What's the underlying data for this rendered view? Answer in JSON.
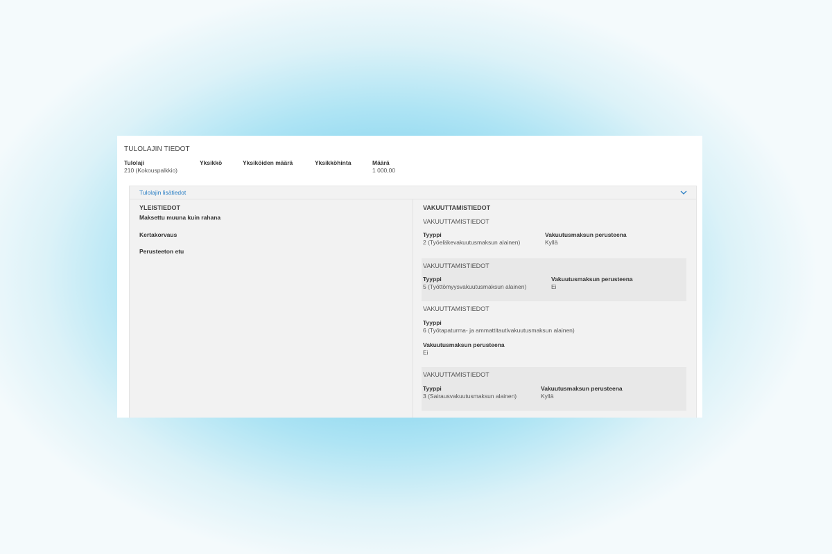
{
  "section_title": "TULOLAJIN TIEDOT",
  "summary": {
    "columns": [
      {
        "label": "Tulolaji",
        "value": "210 (Kokouspalkkio)"
      },
      {
        "label": "Yksikkö",
        "value": ""
      },
      {
        "label": "Yksiköiden määrä",
        "value": ""
      },
      {
        "label": "Yksikköhinta",
        "value": ""
      },
      {
        "label": "Määrä",
        "value": "1 000,00"
      }
    ]
  },
  "details": {
    "title": "Tulolajin lisätiedot",
    "general": {
      "heading": "YLEISTIEDOT",
      "items": [
        "Maksettu muuna kuin rahana",
        "Kertakorvaus",
        "Perusteeton etu"
      ]
    },
    "insurance": {
      "heading": "VAKUUTTAMISTIEDOT",
      "blocks": [
        {
          "heading": "VAKUUTTAMISTIEDOT",
          "type_label": "Tyyppi",
          "type_value": "2 (Työeläkevakuutusmaksun alainen)",
          "basis_label": "Vakuutusmaksun perusteena",
          "basis_value": "Kyllä"
        },
        {
          "heading": "VAKUUTTAMISTIEDOT",
          "type_label": "Tyyppi",
          "type_value": "5 (Työttömyysvakuutusmaksun alainen)",
          "basis_label": "Vakuutusmaksun perusteena",
          "basis_value": "Ei"
        },
        {
          "heading": "VAKUUTTAMISTIEDOT",
          "type_label": "Tyyppi",
          "type_value": "6 (Työtapaturma- ja ammattitautivakuutusmaksun alainen)",
          "basis_label": "Vakuutusmaksun perusteena",
          "basis_value": "Ei"
        },
        {
          "heading": "VAKUUTTAMISTIEDOT",
          "type_label": "Tyyppi",
          "type_value": "3 (Sairausvakuutusmaksun alainen)",
          "basis_label": "Vakuutusmaksun perusteena",
          "basis_value": "Kyllä"
        }
      ]
    }
  }
}
